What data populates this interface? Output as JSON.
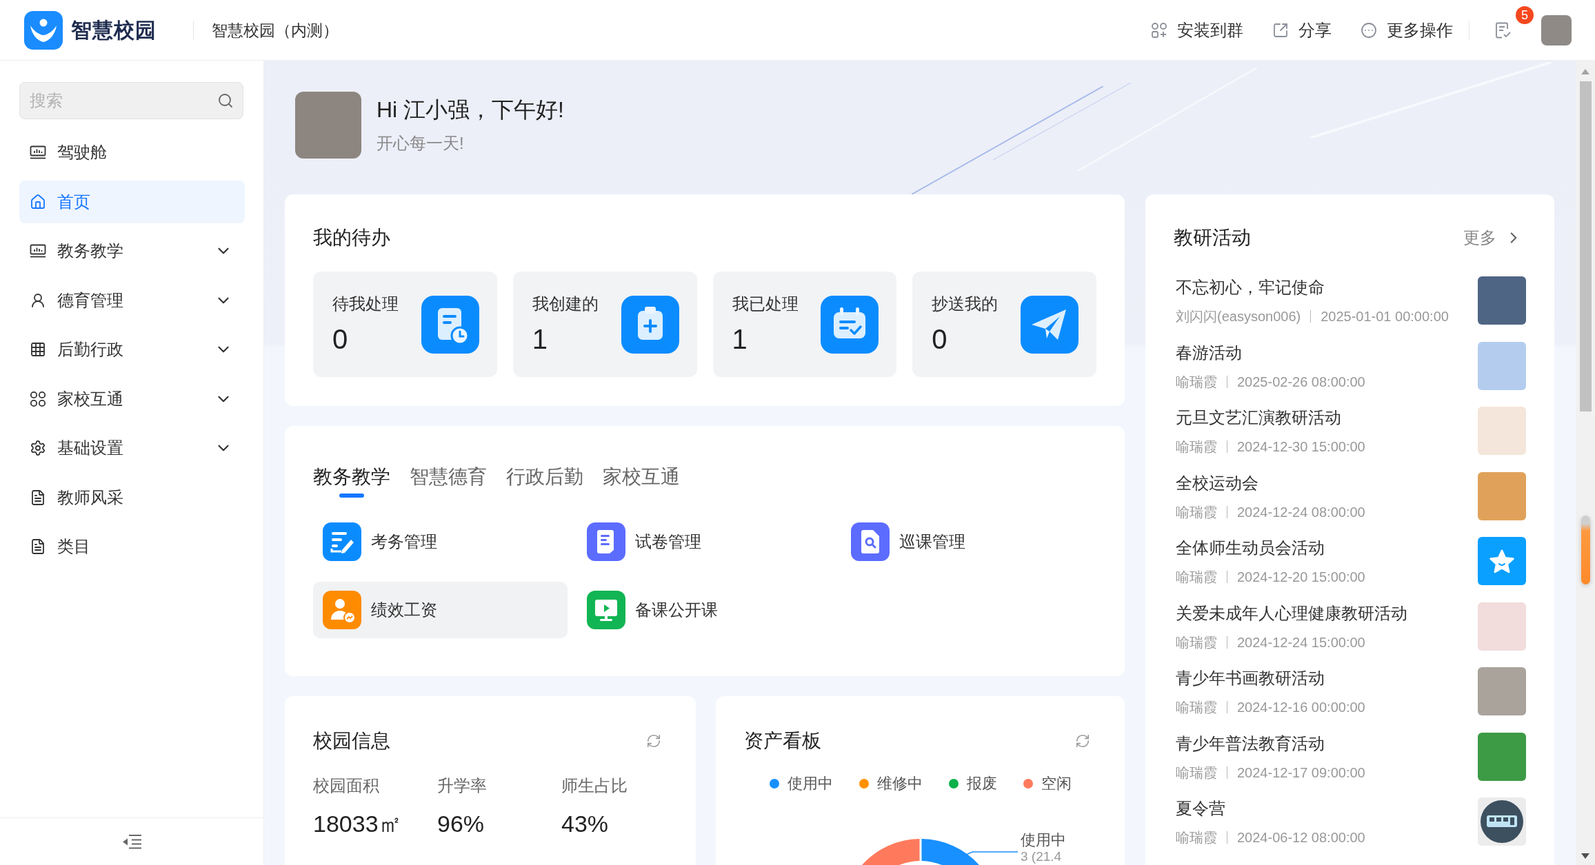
{
  "header": {
    "logo_text": "智慧校园",
    "title": "智慧校园（内测）",
    "actions": [
      {
        "label": "安装到群"
      },
      {
        "label": "分享"
      },
      {
        "label": "更多操作"
      }
    ],
    "notification_count": "5"
  },
  "sidebar": {
    "search": {
      "placeholder": "搜索"
    },
    "items": [
      {
        "label": "驾驶舱",
        "kind": "link",
        "selected": false
      },
      {
        "label": "首页",
        "kind": "link",
        "selected": true
      },
      {
        "label": "教务教学",
        "kind": "group",
        "selected": false,
        "expanded": false
      },
      {
        "label": "德育管理",
        "kind": "group",
        "selected": false,
        "expanded": false
      },
      {
        "label": "后勤行政",
        "kind": "group",
        "selected": false,
        "expanded": false
      },
      {
        "label": "家校互通",
        "kind": "group",
        "selected": false,
        "expanded": false
      },
      {
        "label": "基础设置",
        "kind": "group",
        "selected": false,
        "expanded": false
      },
      {
        "label": "教师风采",
        "kind": "link",
        "selected": false
      },
      {
        "label": "类目",
        "kind": "link",
        "selected": false
      }
    ]
  },
  "greeting": {
    "title": "Hi 江小强，下午好!",
    "subtitle": "开心每一天!"
  },
  "todos": {
    "title": "我的待办",
    "items": [
      {
        "label": "待我处理",
        "count": "0"
      },
      {
        "label": "我创建的",
        "count": "1"
      },
      {
        "label": "我已处理",
        "count": "1"
      },
      {
        "label": "抄送我的",
        "count": "0"
      }
    ]
  },
  "modules": {
    "tabs": [
      {
        "label": "教务教学",
        "selected": true
      },
      {
        "label": "智慧德育",
        "selected": false
      },
      {
        "label": "行政后勤",
        "selected": false
      },
      {
        "label": "家校互通",
        "selected": false
      }
    ],
    "apps": [
      {
        "label": "考务管理",
        "hovered": false
      },
      {
        "label": "试卷管理",
        "hovered": false
      },
      {
        "label": "巡课管理",
        "hovered": false
      },
      {
        "label": "绩效工资",
        "hovered": true
      },
      {
        "label": "备课公开课",
        "hovered": false
      }
    ]
  },
  "campus_info": {
    "title": "校园信息",
    "stats": [
      {
        "label": "校园面积",
        "value": "18033㎡"
      },
      {
        "label": "升学率",
        "value": "96%"
      },
      {
        "label": "师生占比",
        "value": "43%"
      }
    ]
  },
  "asset_board": {
    "title": "资产看板",
    "legend": [
      {
        "label": "使用中",
        "color": "#1890ff"
      },
      {
        "label": "维修中",
        "color": "#ff9000"
      },
      {
        "label": "报废",
        "color": "#0bb04b"
      },
      {
        "label": "空闲",
        "color": "#ff7a5c"
      }
    ],
    "callout": {
      "label": "使用中",
      "value": "3 (21.4"
    }
  },
  "research": {
    "title": "教研活动",
    "more": "更多",
    "items": [
      {
        "title": "不忘初心，牢记使命",
        "author": "刘闪闪(easyson006)",
        "time": "2025-01-01 00:00:00",
        "kind": "photo"
      },
      {
        "title": "春游活动",
        "author": "喻瑞霞",
        "time": "2025-02-26 08:00:00",
        "kind": "photo"
      },
      {
        "title": "元旦文艺汇演教研活动",
        "author": "喻瑞霞",
        "time": "2024-12-30 15:00:00",
        "kind": "photo"
      },
      {
        "title": "全校运动会",
        "author": "喻瑞霞",
        "time": "2024-12-24 08:00:00",
        "kind": "photo"
      },
      {
        "title": "全体师生动员会活动",
        "author": "喻瑞霞",
        "time": "2024-12-20 15:00:00",
        "kind": "star"
      },
      {
        "title": "关爱未成年人心理健康教研活动",
        "author": "喻瑞霞",
        "time": "2024-12-24 15:00:00",
        "kind": "photo"
      },
      {
        "title": "青少年书画教研活动",
        "author": "喻瑞霞",
        "time": "2024-12-16 00:00:00",
        "kind": "photo"
      },
      {
        "title": "青少年普法教育活动",
        "author": "喻瑞霞",
        "time": "2024-12-17 09:00:00",
        "kind": "photo"
      },
      {
        "title": "夏令营",
        "author": "喻瑞霞",
        "time": "2024-06-12 08:00:00",
        "kind": "bus"
      }
    ]
  }
}
